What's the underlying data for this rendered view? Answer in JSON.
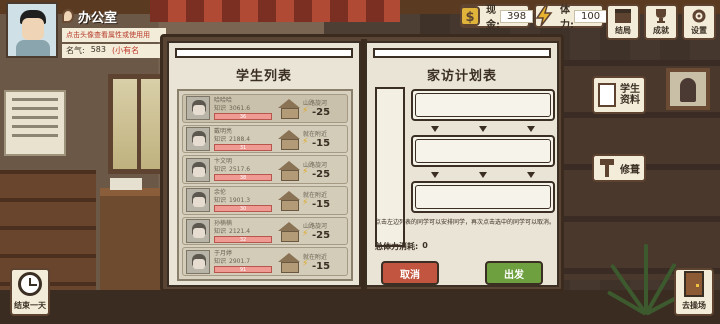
{
  "location": {
    "name": "办公室"
  },
  "tip": "点击头像查看属性或使用用",
  "fame": {
    "label": "名气:",
    "value": "583",
    "rank": "(小有名"
  },
  "resources": {
    "cash": {
      "label": "现金:",
      "value": "398"
    },
    "energy": {
      "label": "体力:",
      "value": "100"
    }
  },
  "top_buttons": {
    "end": "结局",
    "achievement": "成就",
    "settings": "设置"
  },
  "side": {
    "student_data": [
      "学生",
      "资料"
    ],
    "renovate": "修葺"
  },
  "corner": {
    "end_day": "结束一天",
    "playground": "去操场"
  },
  "student_list": {
    "title": "学生列表",
    "knowledge_label": "知识",
    "students": [
      {
        "name": "哈哈哈",
        "knowledge": "3061.6",
        "hp": "36",
        "location": "山路旋河",
        "cost": "-25"
      },
      {
        "name": "戴明亮",
        "knowledge": "2188.4",
        "hp": "31",
        "location": "就在附近",
        "cost": "-15"
      },
      {
        "name": "卞文明",
        "knowledge": "2517.6",
        "hp": "38",
        "location": "山路旋河",
        "cost": "-25"
      },
      {
        "name": "余伦",
        "knowledge": "1901.3",
        "hp": "30",
        "location": "就在附近",
        "cost": "-15"
      },
      {
        "name": "孙楠楠",
        "knowledge": "2121.4",
        "hp": "32",
        "location": "山路旋河",
        "cost": "-25"
      },
      {
        "name": "于月婷",
        "knowledge": "2901.7",
        "hp": "91",
        "location": "就在附近",
        "cost": "-15"
      }
    ]
  },
  "visit_plan": {
    "title": "家访计划表",
    "instructions": "点击左边列表的同学可以安排同学，再次点击选中的同学可以取消。",
    "total_label": "总体力消耗:",
    "total_value": "0",
    "cancel": "取消",
    "depart": "出发"
  }
}
